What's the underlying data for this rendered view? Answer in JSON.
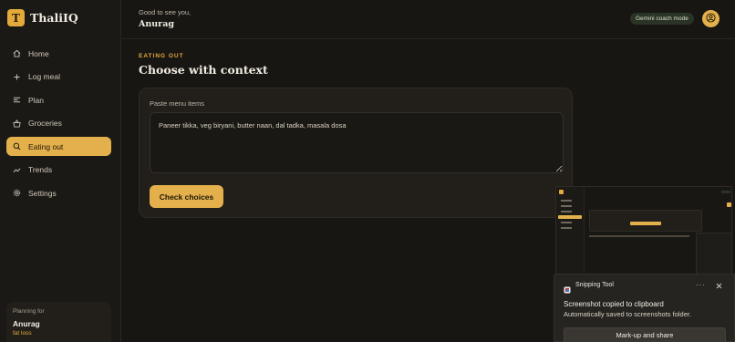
{
  "app": {
    "name": "ThaliIQ",
    "logo_letter": "T"
  },
  "sidebar": {
    "items": [
      {
        "label": "Home",
        "icon": "home-icon"
      },
      {
        "label": "Log meal",
        "icon": "plus-icon"
      },
      {
        "label": "Plan",
        "icon": "list-icon"
      },
      {
        "label": "Groceries",
        "icon": "basket-icon"
      },
      {
        "label": "Eating out",
        "icon": "search-icon",
        "active": true
      },
      {
        "label": "Trends",
        "icon": "trend-icon"
      },
      {
        "label": "Settings",
        "icon": "gear-icon"
      }
    ],
    "planning": {
      "label": "Planning for",
      "name": "Anurag",
      "goal": "fat loss"
    }
  },
  "header": {
    "greeting": "Good to see you,",
    "user": "Anurag",
    "mode_badge": "Gemini coach mode",
    "avatar_icon": "user-circle-icon"
  },
  "main": {
    "eyebrow": "EATING OUT",
    "title": "Choose with context",
    "field_label": "Paste menu items",
    "menu_value": "Paneer tikka, veg biryani, butter naan, dal tadka, masala dosa",
    "button": "Check choices"
  },
  "toast": {
    "app": "Snipping Tool",
    "more": "···",
    "title": "Screenshot copied to clipboard",
    "body": "Automatically saved to screenshots folder.",
    "button": "Mark-up and share"
  },
  "colors": {
    "accent": "#e3b04c",
    "background": "#181613",
    "sidebar": "#1b1915",
    "card": "#221f1a"
  }
}
